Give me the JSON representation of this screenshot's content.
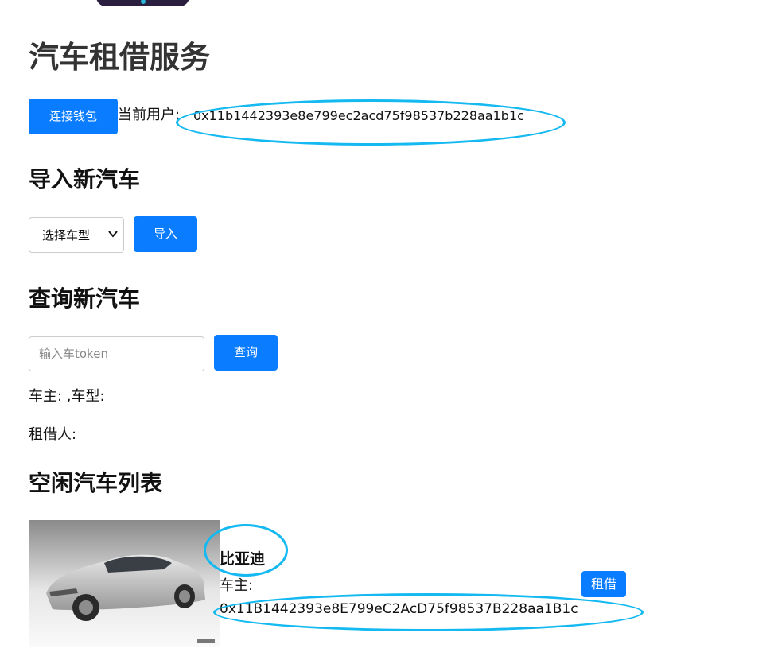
{
  "page": {
    "title": "汽车租借服务"
  },
  "wallet": {
    "connect_label": "连接钱包",
    "user_label": "当前用户:",
    "user_address": "0x11b1442393e8e799ec2acd75f98537b228aa1b1c"
  },
  "import_section": {
    "heading": "导入新汽车",
    "select_value": "选择车型",
    "button_label": "导入"
  },
  "query_section": {
    "heading": "查询新汽车",
    "input_placeholder": "输入车token",
    "input_value": "",
    "button_label": "查询",
    "owner_line": "车主: ,车型:",
    "renter_line": "租借人:"
  },
  "list_section": {
    "heading": "空闲汽车列表",
    "cars": [
      {
        "name": "比亚迪",
        "owner_label": "车主:",
        "owner_address": "0x11B1442393e8E799eC2AcD75f98537B228aa1B1c",
        "rent_label": "租借"
      }
    ]
  },
  "colors": {
    "primary_button": "#0a7cff",
    "annotation_ellipse": "#13b9f0",
    "title_text": "#333333"
  },
  "icons": {
    "select_arrow": "chevron-down-icon"
  }
}
